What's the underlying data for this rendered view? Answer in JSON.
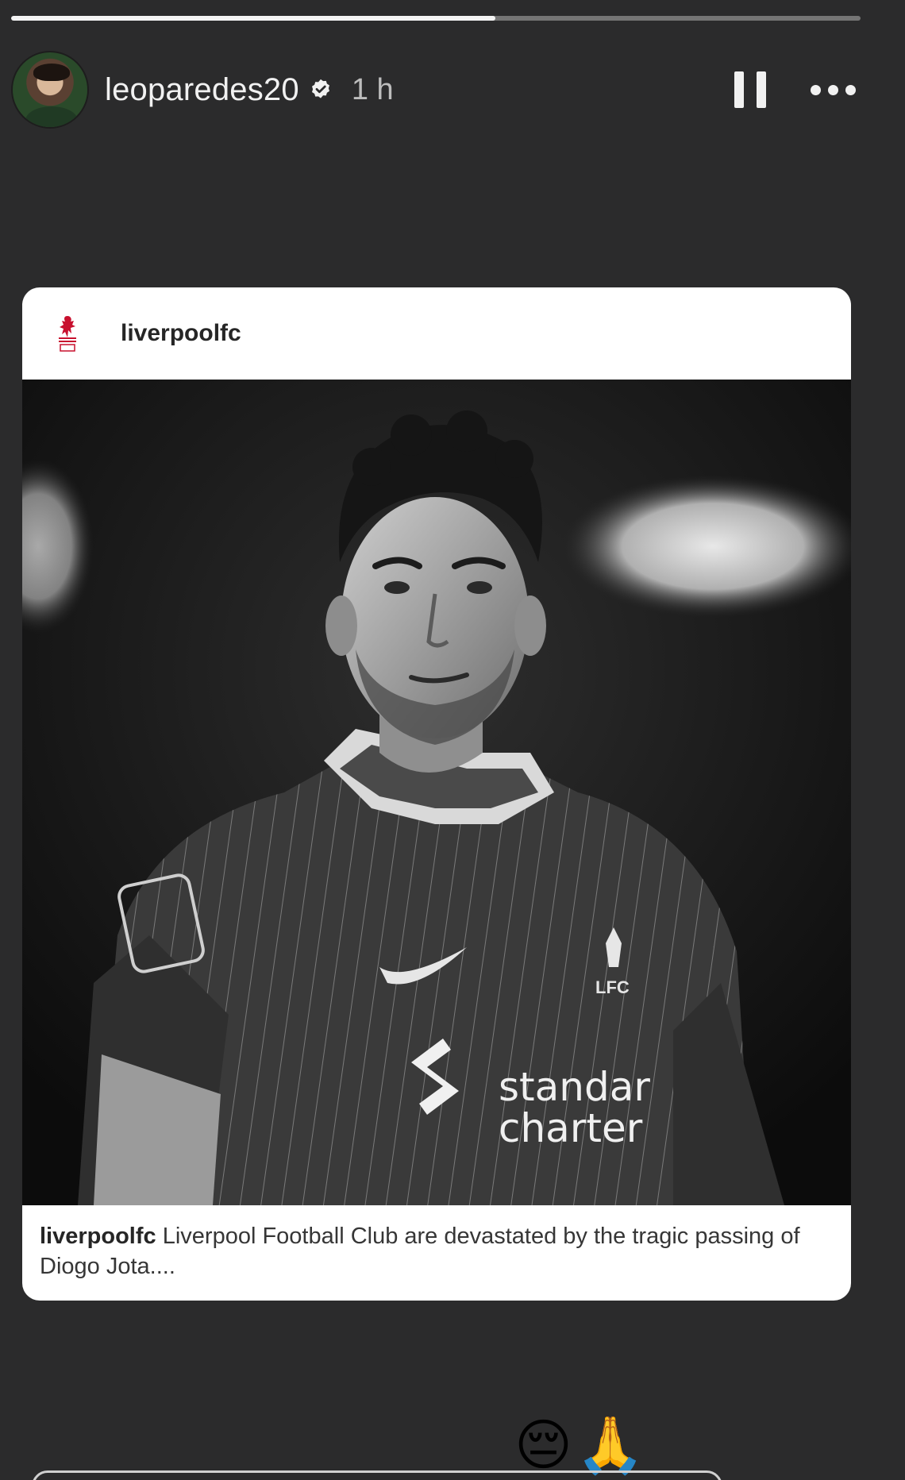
{
  "story": {
    "progress_fraction": 0.57,
    "author": {
      "username": "leoparedes20",
      "verified": true,
      "time": "1 h"
    }
  },
  "icons": {
    "pause": "pause-icon",
    "more": "more-options-icon",
    "verified": "verified-badge-icon",
    "club": "liverpool-liverbird-logo"
  },
  "post": {
    "username": "liverpoolfc",
    "image_text": {
      "sponsor_line1": "standar",
      "sponsor_line2": "charter",
      "crest": "LFC"
    },
    "caption_username": "liverpoolfc",
    "caption_text": "Liverpool Football Club are devastated by the tragic passing of Diogo Jota...."
  },
  "reactions": [
    "😔",
    "🙏"
  ],
  "colors": {
    "background": "#2b2b2c",
    "card": "#ffffff",
    "lfc_red": "#c8102e"
  }
}
